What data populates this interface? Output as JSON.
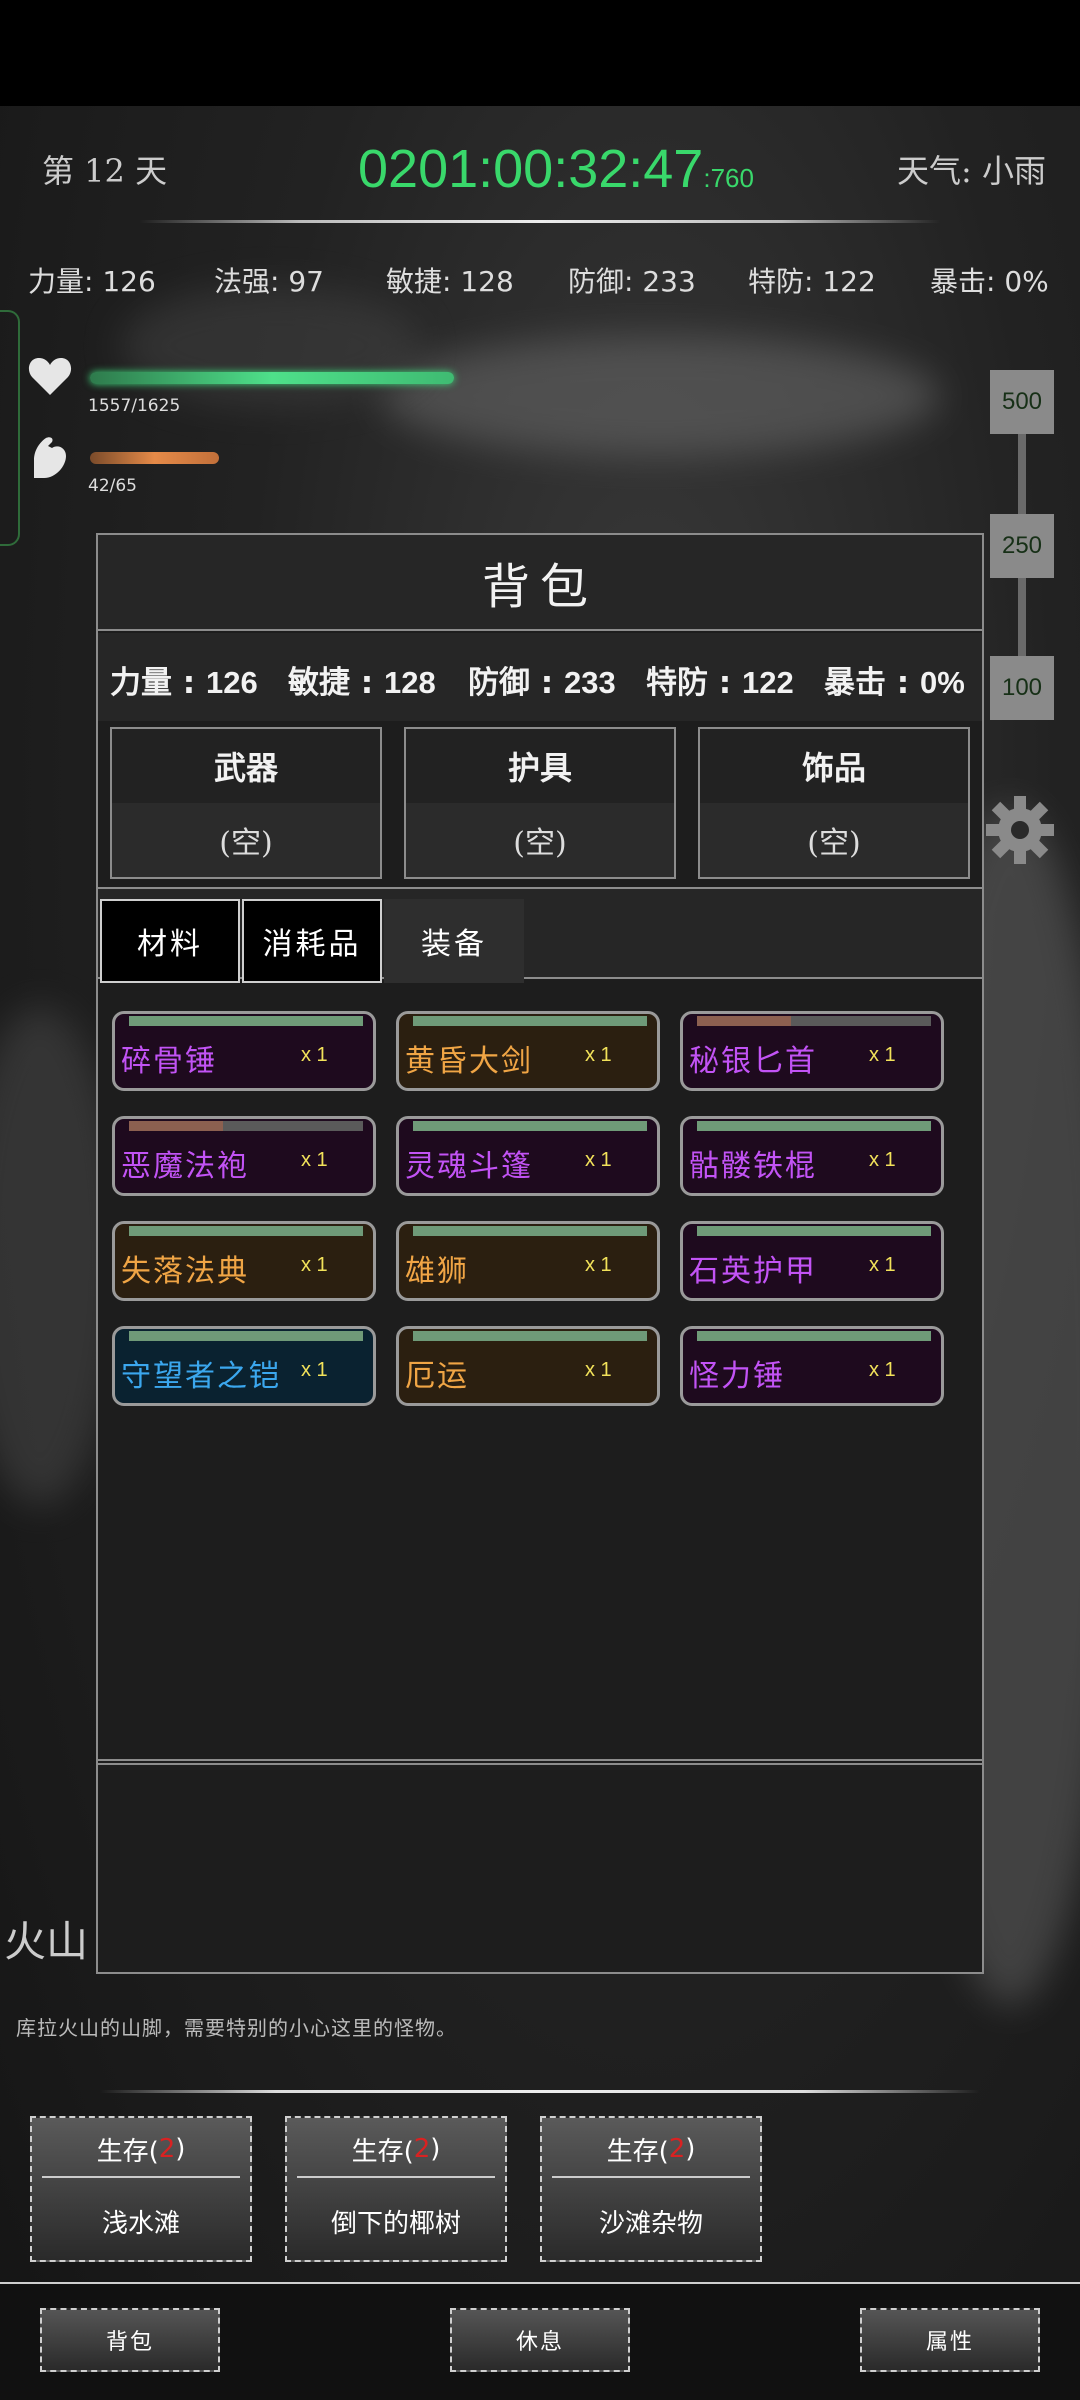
{
  "header": {
    "day": "第 12 天",
    "clock_main": "0201:00:32:47",
    "clock_ms": ":760",
    "weather": "天气: 小雨"
  },
  "stats": [
    {
      "label": "力量: 126"
    },
    {
      "label": "法强: 97"
    },
    {
      "label": "敏捷: 128"
    },
    {
      "label": "防御: 233"
    },
    {
      "label": "特防: 122"
    },
    {
      "label": "暴击: 0%"
    }
  ],
  "vitals": {
    "hp_text": "1557/1625",
    "hp_fraction": 0.958,
    "stamina_text": "42/65",
    "stamina_fraction": 0.646,
    "hp_color": "#4ee08a",
    "stamina_color": "#e58a48"
  },
  "scale": {
    "tags": [
      "500",
      "250",
      "100"
    ]
  },
  "bag": {
    "title": "背包",
    "stats": [
      {
        "label": "力量",
        "value": "126"
      },
      {
        "label": "敏捷",
        "value": "128"
      },
      {
        "label": "防御",
        "value": "233"
      },
      {
        "label": "特防",
        "value": "122"
      },
      {
        "label": "暴击",
        "value": "0%"
      }
    ],
    "slots": [
      {
        "label": "武器",
        "value": "(空)"
      },
      {
        "label": "护具",
        "value": "(空)"
      },
      {
        "label": "饰品",
        "value": "(空)"
      }
    ],
    "tabs": [
      "材料",
      "消耗品",
      "装备"
    ],
    "active_tab": "装备",
    "items": [
      {
        "name": "碎骨锤",
        "qty": "x 1",
        "rarity": "purple",
        "durability": 1.0
      },
      {
        "name": "黄昏大剑",
        "qty": "x 1",
        "rarity": "orange",
        "durability": 1.0
      },
      {
        "name": "秘银匕首",
        "qty": "x 1",
        "rarity": "purple",
        "durability": 0.4
      },
      {
        "name": "恶魔法袍",
        "qty": "x 1",
        "rarity": "purple",
        "durability": 0.4
      },
      {
        "name": "灵魂斗篷",
        "qty": "x 1",
        "rarity": "purple",
        "durability": 1.0
      },
      {
        "name": "骷髅铁棍",
        "qty": "x 1",
        "rarity": "purple",
        "durability": 1.0
      },
      {
        "name": "失落法典",
        "qty": "x 1",
        "rarity": "orange",
        "durability": 1.0
      },
      {
        "name": "雄狮",
        "qty": "x 1",
        "rarity": "orange",
        "durability": 1.0
      },
      {
        "name": "石英护甲",
        "qty": "x 1",
        "rarity": "purple",
        "durability": 1.0
      },
      {
        "name": "守望者之铠",
        "qty": "x 1",
        "rarity": "blue",
        "durability": 1.0
      },
      {
        "name": "厄运",
        "qty": "x 1",
        "rarity": "orange",
        "durability": 1.0
      },
      {
        "name": "怪力锤",
        "qty": "x 1",
        "rarity": "purple",
        "durability": 1.0
      }
    ]
  },
  "location": {
    "name": "火山",
    "description": "库拉火山的山脚，需要特别的小心这里的怪物。"
  },
  "actions": [
    {
      "prefix": "生存(",
      "count": "2",
      "suffix": ")",
      "label": "浅水滩"
    },
    {
      "prefix": "生存(",
      "count": "2",
      "suffix": ")",
      "label": "倒下的椰树"
    },
    {
      "prefix": "生存(",
      "count": "2",
      "suffix": ")",
      "label": "沙滩杂物"
    }
  ],
  "nav": [
    "背包",
    "休息",
    "属性"
  ]
}
